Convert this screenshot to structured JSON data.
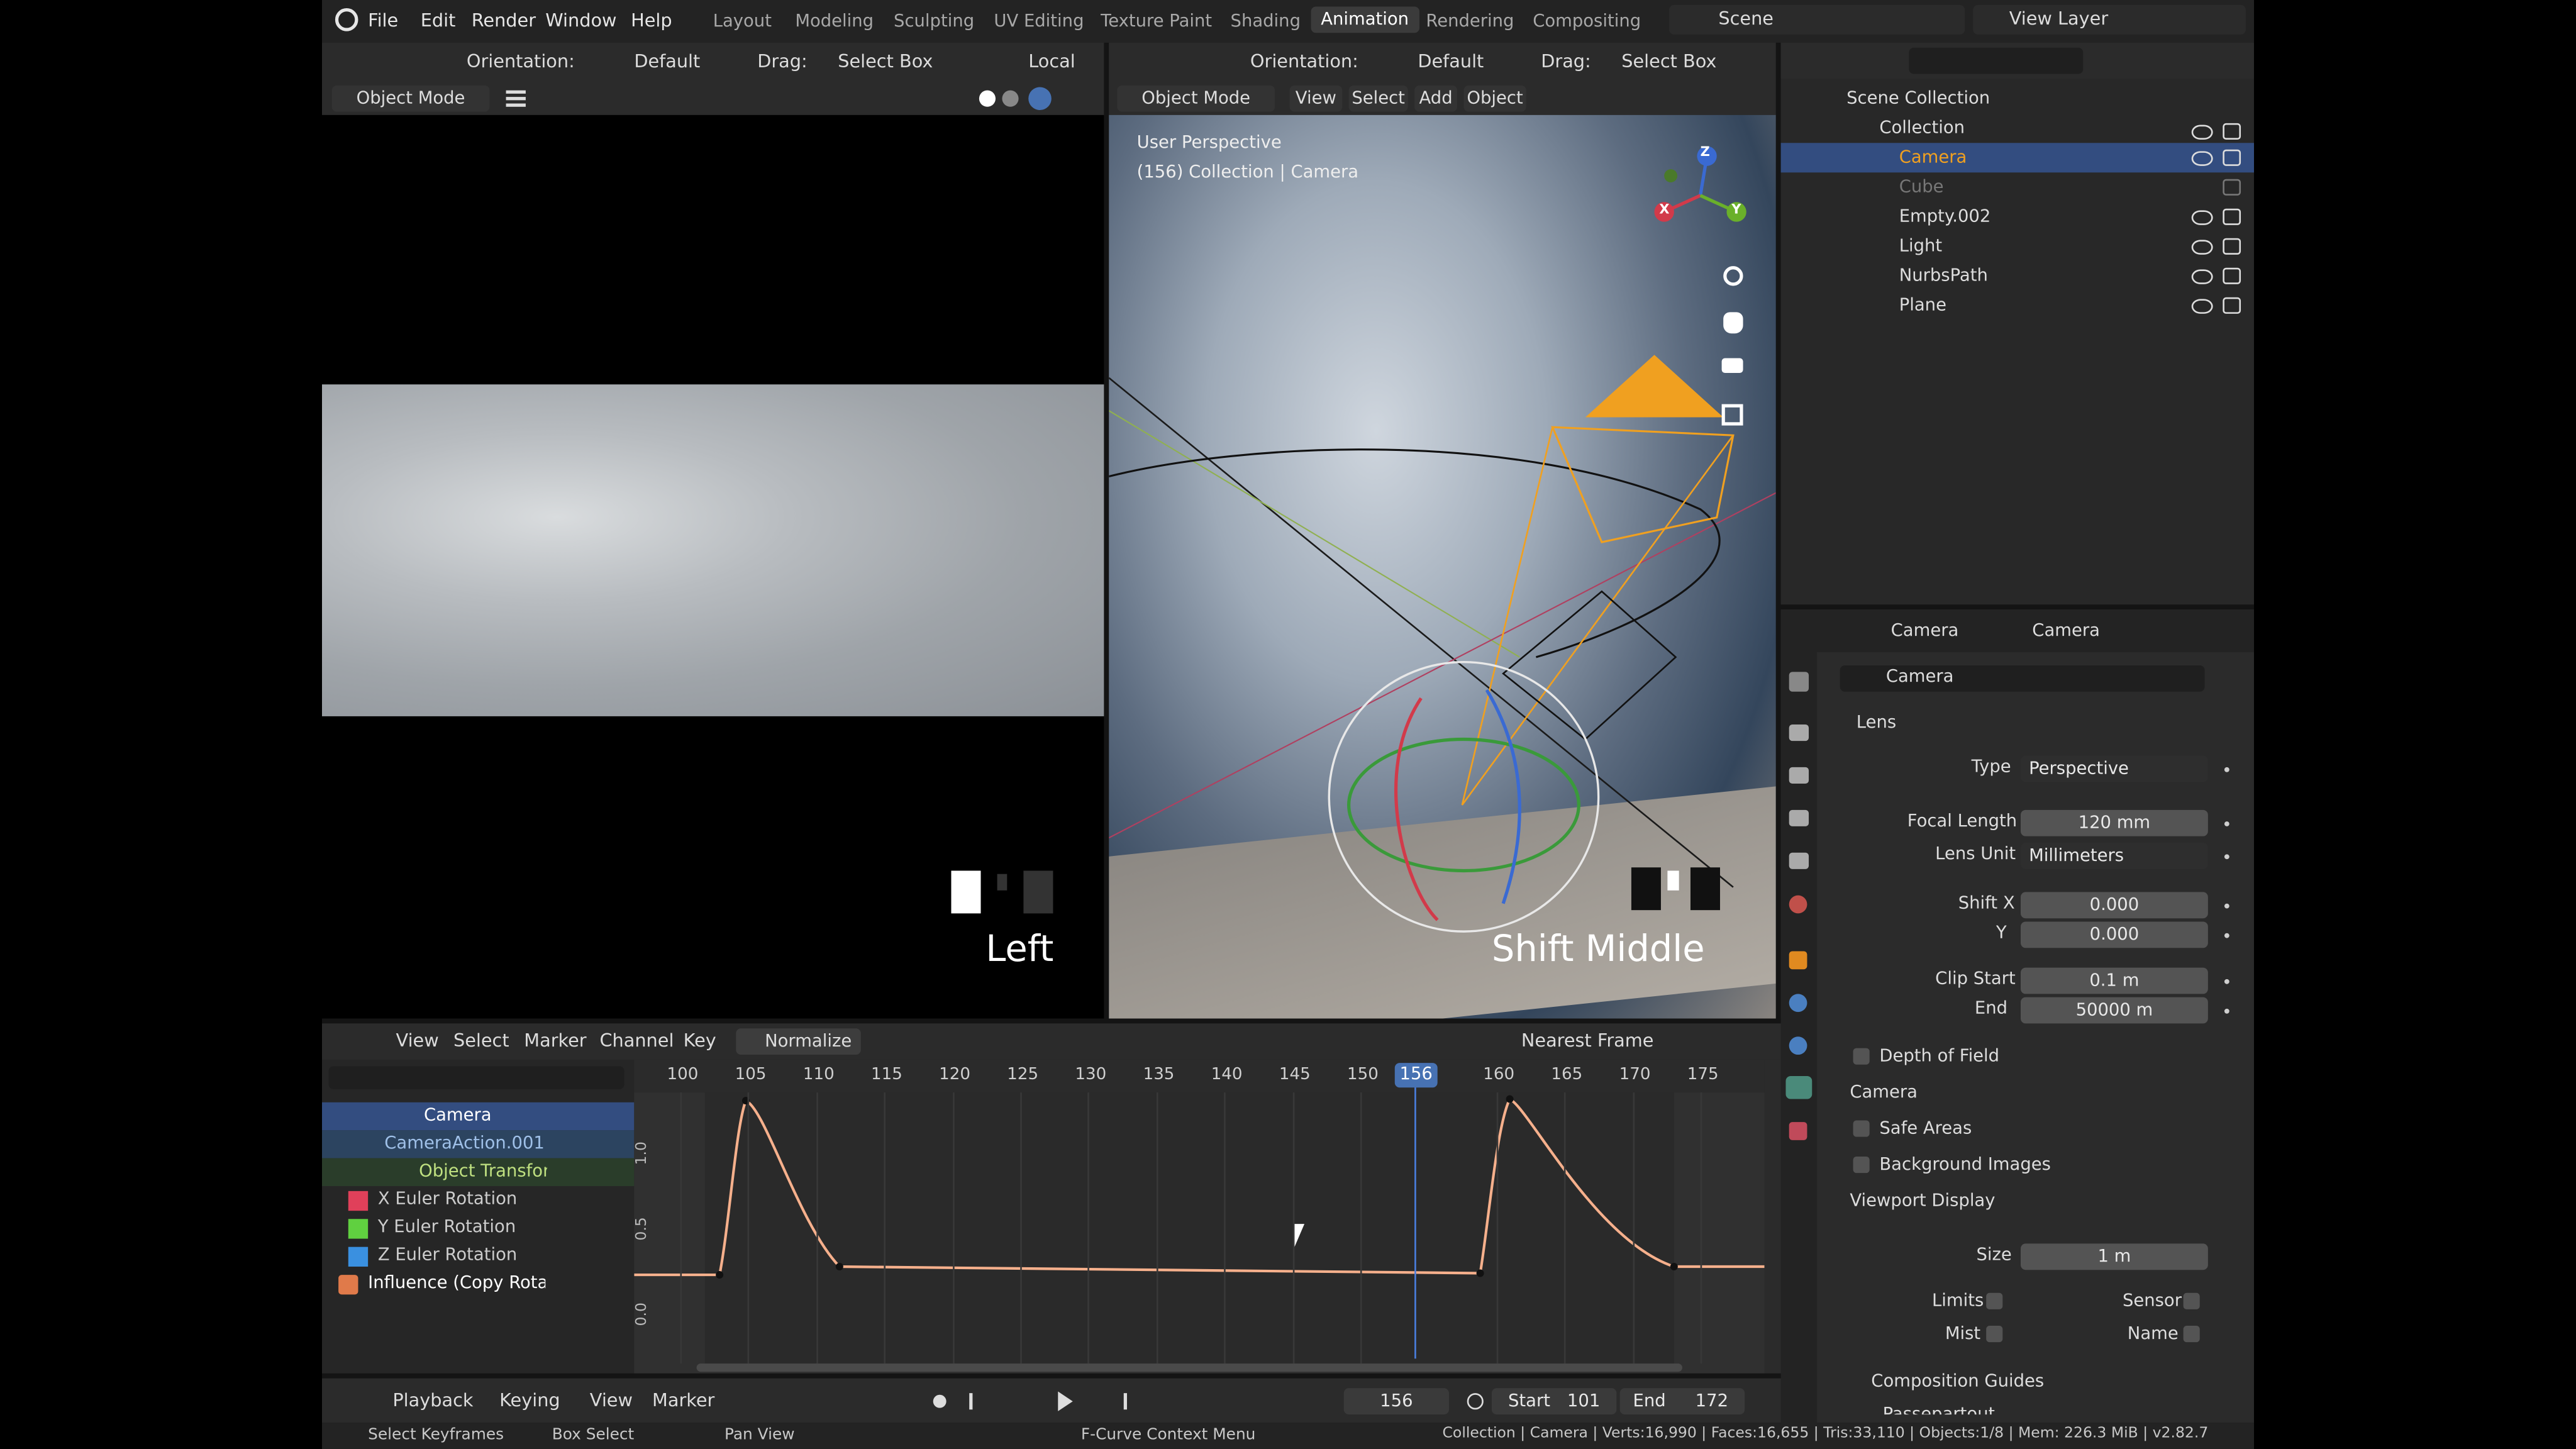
{
  "menus": [
    "File",
    "Edit",
    "Render",
    "Window",
    "Help"
  ],
  "workspaces": [
    "Layout",
    "Modeling",
    "Sculpting",
    "UV Editing",
    "Texture Paint",
    "Shading",
    "Animation",
    "Rendering",
    "Compositing"
  ],
  "active_workspace": "Animation",
  "scene": "Scene",
  "view_layer": "View Layer",
  "left_header": {
    "orientation": "Orientation:",
    "orient_val": "Default",
    "drag": "Drag:",
    "drag_val": "Select Box",
    "pivot": "Local",
    "mode": "Object Mode"
  },
  "right_header": {
    "orientation": "Orientation:",
    "orient_val": "Default",
    "drag": "Drag:",
    "drag_val": "Select Box",
    "mode": "Object Mode",
    "menus": [
      "View",
      "Select",
      "Add",
      "Object"
    ]
  },
  "viewport": {
    "persp": "User Perspective",
    "info": "(156) Collection | Camera"
  },
  "overlays": {
    "left_key": "Left",
    "right_key": "Shift Middle"
  },
  "gizmo": {
    "x": "X",
    "y": "Y",
    "z": "Z"
  },
  "outliner": {
    "root": "Scene Collection",
    "collection": "Collection",
    "items": [
      {
        "name": "Camera",
        "selected": true
      },
      {
        "name": "Cube",
        "dim": true
      },
      {
        "name": "Empty.002"
      },
      {
        "name": "Light"
      },
      {
        "name": "NurbsPath"
      },
      {
        "name": "Plane"
      }
    ]
  },
  "properties": {
    "bc1": "Camera",
    "bc2": "Camera",
    "data_name": "Camera",
    "lens_panel": "Lens",
    "type_label": "Type",
    "type_val": "Perspective",
    "focal_label": "Focal Length",
    "focal_val": "120 mm",
    "unit_label": "Lens Unit",
    "unit_val": "Millimeters",
    "shiftx_label": "Shift X",
    "shiftx_val": "0.000",
    "shifty_label": "Y",
    "shifty_val": "0.000",
    "clipstart_label": "Clip Start",
    "clipstart_val": "0.1 m",
    "clipend_label": "End",
    "clipend_val": "50000 m",
    "panels": [
      "Depth of Field",
      "Camera",
      "Safe Areas",
      "Background Images"
    ],
    "vd_panel": "Viewport Display",
    "size_label": "Size",
    "size_val": "1 m",
    "limits": "Limits",
    "sensor": "Sensor",
    "mist": "Mist",
    "name": "Name",
    "comp": "Composition Guides",
    "cutoff": "Passepartout"
  },
  "graph": {
    "menus": [
      "View",
      "Select",
      "Marker",
      "Channel",
      "Key"
    ],
    "normalize": "Normalize",
    "snap": "Nearest Frame",
    "ticks": [
      "100",
      "105",
      "110",
      "115",
      "120",
      "125",
      "130",
      "135",
      "140",
      "145",
      "150",
      "156",
      "160",
      "165",
      "170",
      "175"
    ],
    "current_frame": "156",
    "yticks": [
      "1.0",
      "0.5",
      "0.0"
    ],
    "channels": [
      "Camera",
      "CameraAction.001",
      "Object Transform",
      "X Euler Rotation",
      "Y Euler Rotation",
      "Z Euler Rotation",
      "Influence (Copy Rotatio"
    ]
  },
  "timeline": {
    "menus": [
      "Playback",
      "Keying",
      "View",
      "Marker"
    ],
    "frame": "156",
    "start_label": "Start",
    "start": "101",
    "end_label": "End",
    "end": "172"
  },
  "status": {
    "a": "Select Keyframes",
    "b": "Box Select",
    "c": "Pan View",
    "d": "F-Curve Context Menu",
    "stats": "Collection | Camera | Verts:16,990 | Faces:16,655 | Tris:33,110 | Objects:1/8 | Mem: 226.3 MiB | v2.82.7"
  },
  "colors": {
    "accent": "#4772b3",
    "orange": "#f0a020",
    "curve": "#f6b08c",
    "bg": "#1d1d1d"
  }
}
